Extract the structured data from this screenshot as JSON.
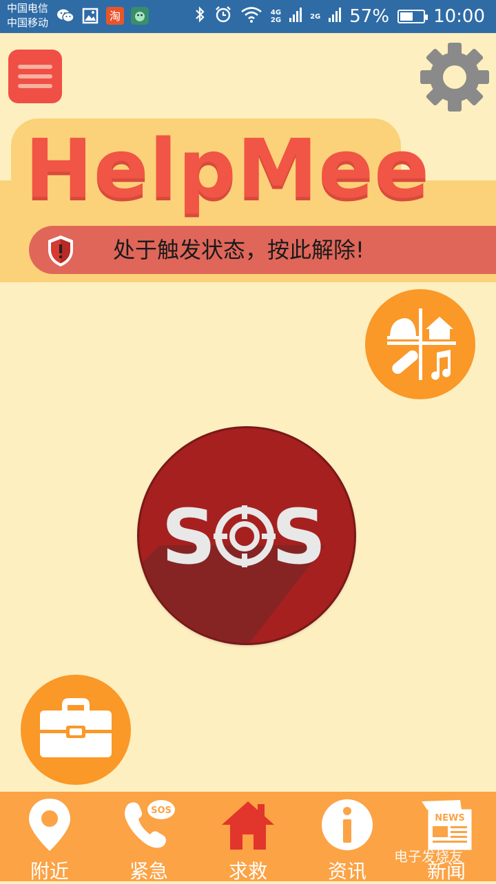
{
  "status_bar": {
    "carrier_1": "中国电信",
    "carrier_2": "中国移动",
    "net_1_top": "4G",
    "net_1_bottom": "2G",
    "net_2": "2G",
    "battery": "57%",
    "battery_level": 0.57,
    "time": "10:00",
    "icons": [
      "wechat-icon",
      "gallery-icon",
      "taobao-icon",
      "app-icon",
      "bluetooth-icon",
      "alarm-icon",
      "wifi-icon"
    ]
  },
  "header": {
    "logo_text": "HelpMee",
    "alert_text": "处于触发状态，按此解除!"
  },
  "main": {
    "sos_label": "SOS"
  },
  "nav": {
    "items": [
      {
        "label": "附近",
        "icon": "location-pin-icon"
      },
      {
        "label": "紧急",
        "icon": "phone-sos-icon"
      },
      {
        "label": "求救",
        "icon": "home-icon"
      },
      {
        "label": "资讯",
        "icon": "info-icon"
      },
      {
        "label": "新闻",
        "icon": "news-icon"
      }
    ]
  },
  "watermark": "电子发烧友",
  "colors": {
    "background": "#FDEFC0",
    "status_bar": "#2F6CA6",
    "accent_red": "#F05545",
    "orange": "#FA9828",
    "sos_red": "#A62020",
    "nav_bg": "#FBA345"
  }
}
